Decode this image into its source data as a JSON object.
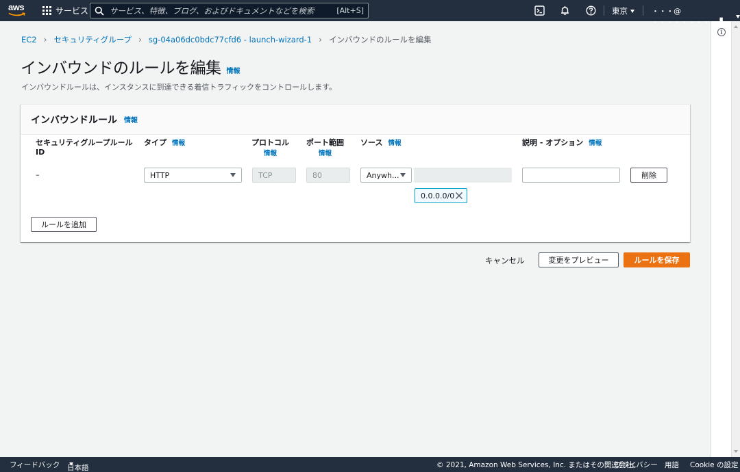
{
  "topnav": {
    "logo_text": "aws",
    "services_label": "サービス",
    "search_placeholder": "サービス、特徴、ブログ、およびドキュメントなどを検索",
    "search_shortcut": "[Alt+S]",
    "region": "東京",
    "account": "・・・@ ・・・・・・・・・ ▌"
  },
  "breadcrumb": {
    "items": [
      "EC2",
      "セキュリティグループ",
      "sg-04a06dc0bdc77cfd6 - launch-wizard-1"
    ],
    "current": "インバウンドのルールを編集"
  },
  "page": {
    "title": "インバウンドのルールを編集",
    "info": "情報",
    "description": "インバウンドルールは、インスタンスに到達できる着信トラフィックをコントロールします。"
  },
  "panel": {
    "title": "インバウンドルール",
    "info": "情報",
    "columns": {
      "rule_id": "セキュリティグループルール ID",
      "type": "タイプ",
      "protocol": "プロトコル",
      "port_range": "ポート範囲",
      "source": "ソース",
      "description": "説明 - オプション"
    },
    "row": {
      "rule_id": "–",
      "type": "HTTP",
      "protocol": "TCP",
      "port": "80",
      "source": "Anywh...",
      "token": "0.0.0.0/0",
      "description_value": "",
      "delete_label": "削除"
    },
    "add_rule_label": "ルールを追加"
  },
  "actions": {
    "cancel": "キャンセル",
    "preview": "変更をプレビュー",
    "save": "ルールを保存"
  },
  "footer": {
    "feedback": "フィードバック",
    "language": "日本語",
    "copyright": "© 2021, Amazon Web Services, Inc. またはその関連会社。",
    "privacy": "プライバシー",
    "terms": "用語",
    "cookies": "Cookie の設定"
  },
  "colors": {
    "nav_bg": "#232f3e",
    "link": "#0073bb",
    "primary": "#ec7211",
    "token_border": "#00a1c9"
  }
}
